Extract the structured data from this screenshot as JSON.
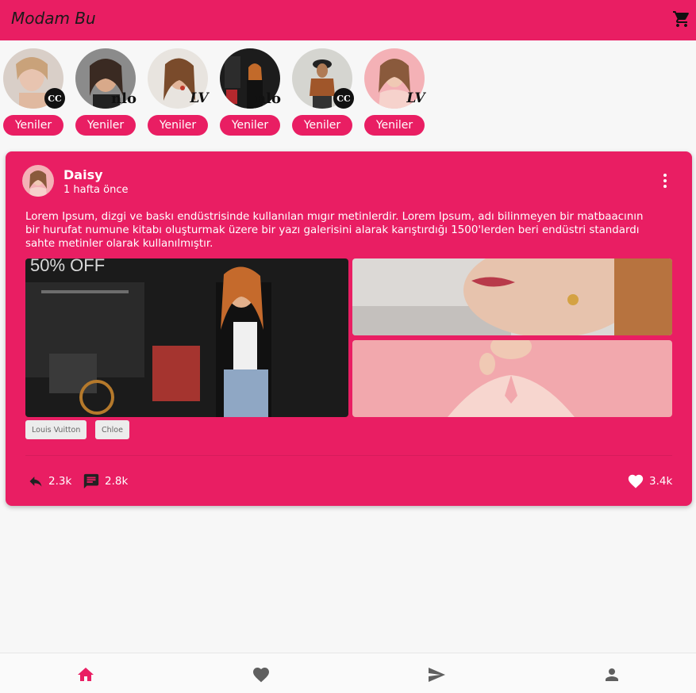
{
  "app": {
    "title": "Modam Bu",
    "accent": "#e91e63"
  },
  "stories": [
    {
      "label": "Yeniler",
      "brand": "CC"
    },
    {
      "label": "Yeniler",
      "brand": "nlo"
    },
    {
      "label": "Yeniler",
      "brand": "LV"
    },
    {
      "label": "Yeniler",
      "brand": "nlo"
    },
    {
      "label": "Yeniler",
      "brand": "CC"
    },
    {
      "label": "Yeniler",
      "brand": "LV"
    }
  ],
  "post": {
    "user": "Daisy",
    "time": "1 hafta önce",
    "text": "Lorem Ipsum, dizgi ve baskı endüstrisinde kullanılan mıgır metinlerdir. Lorem Ipsum, adı bilinmeyen bir matbaacının bir hurufat numune kitabı oluşturmak üzere bir yazı galerisini alarak karıştırdığı 1500'lerden beri endüstri standardı sahte metinler olarak kullanılmıştır.",
    "image_overlay": "50% OFF",
    "tags": [
      "Louis Vuitton",
      "Chloe"
    ],
    "shares": "2.3k",
    "comments": "2.8k",
    "likes": "3.4k"
  },
  "nav": {
    "icons": [
      "home-icon",
      "heart-icon",
      "send-icon",
      "person-icon"
    ]
  }
}
